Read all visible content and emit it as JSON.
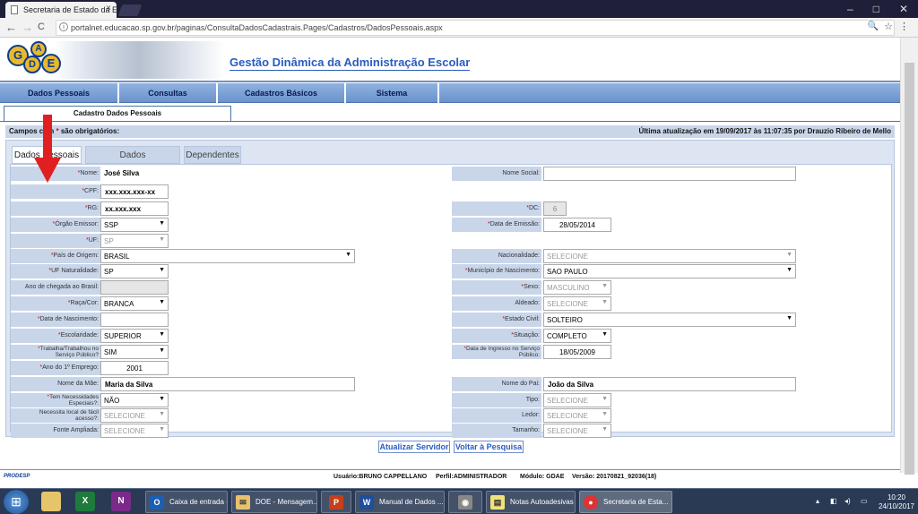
{
  "browser": {
    "tab_title": "Secretaria de Estado da E",
    "tab_close": "×",
    "back": "←",
    "forward": "→",
    "reload": "C",
    "url": "portalnet.educacao.sp.gov.br/paginas/ConsultaDadosCadastrais.Pages/Cadastros/DadosPessoais.aspx",
    "win_min": "–",
    "win_max": "□",
    "win_close": "✕"
  },
  "header": {
    "logo_letters": [
      "G",
      "D",
      "A",
      "E"
    ],
    "title": "Gestão Dinâmica da Administração Escolar"
  },
  "topnav": [
    "Dados Pessoais",
    "Consultas",
    "Cadastros Básicos",
    "Sistema"
  ],
  "subtab": "Cadastro Dados Pessoais",
  "info": {
    "required_prefix": "Campos com",
    "required_star": "*",
    "required_suffix": " são obrigatórios:",
    "last_update": "Última atualização em 19/09/2017 às 11:07:35 por Drauzio Ribeiro de Mello"
  },
  "form_tabs": [
    "Dados Pessoais",
    "Dados Complementares",
    "Dependentes"
  ],
  "form": {
    "nome": {
      "label": "Nome:",
      "value": "José Silva"
    },
    "nome_social": {
      "label": "Nome Social:",
      "value": ""
    },
    "cpf": {
      "label": "CPF:",
      "value": "xxx.xxx.xxx-xx"
    },
    "rg": {
      "label": "RG:",
      "value": "xx.xxx.xxx"
    },
    "dc": {
      "label": "DC:",
      "value": "6"
    },
    "orgao": {
      "label": "Órgão Emissor:",
      "value": "SSP"
    },
    "data_emissao": {
      "label": "Data de Emissão:",
      "value": "28/05/2014"
    },
    "uf": {
      "label": "UF:",
      "value": "SP"
    },
    "pais": {
      "label": "País de Origem:",
      "value": "BRASIL"
    },
    "nacionalidade": {
      "label": "Nacionalidade:",
      "value": "SELECIONE"
    },
    "uf_nat": {
      "label": "UF Naturalidade:",
      "value": "SP"
    },
    "municipio": {
      "label": "Município de Nascimento:",
      "value": "SAO PAULO"
    },
    "ano_chegada": {
      "label": "Ano de chegada ao Brasil:",
      "value": ""
    },
    "sexo": {
      "label": "Sexo:",
      "value": "MASCULINO"
    },
    "raca": {
      "label": "Raça/Cor:",
      "value": "BRANCA"
    },
    "aldeado": {
      "label": "Aldeado:",
      "value": "SELECIONE"
    },
    "data_nasc": {
      "label": "Data de Nascimento:",
      "value": ""
    },
    "estado_civil": {
      "label": "Estado Civil:",
      "value": "SOLTEIRO"
    },
    "escolaridade": {
      "label": "Escolaridade:",
      "value": "SUPERIOR"
    },
    "situacao": {
      "label": "Situação:",
      "value": "COMPLETO"
    },
    "trabalha_l1": "Trabalha/Trabalhou no",
    "trabalha_l2": "Serviço Público?",
    "trabalha_value": "SIM",
    "ingresso_l1": "Data de Ingresso no Serviço",
    "ingresso_l2": "Público:",
    "ingresso_value": "18/05/2009",
    "ano_emprego": {
      "label": "Ano do 1º Emprego:",
      "value": "2001"
    },
    "mae": {
      "label": "Nome da Mãe:",
      "value": "Maria da Silva"
    },
    "pai": {
      "label": "Nome do Pai:",
      "value": "João da Silva"
    },
    "necess_l1": "Tem Necessidades",
    "necess_l2": "Especiais?:",
    "necess_value": "NÃO",
    "tipo": {
      "label": "Tipo:",
      "value": "SELECIONE"
    },
    "local_l1": "Necessita local de fácil",
    "local_l2": "acesso?:",
    "local_value": "SELECIONE",
    "ledor": {
      "label": "Ledor:",
      "value": "SELECIONE"
    },
    "fonte": {
      "label": "Fonte Ampliada:",
      "value": "SELECIONE"
    },
    "tamanho": {
      "label": "Tamanho:",
      "value": "SELECIONE"
    }
  },
  "star": "*",
  "arrow_char": "▼",
  "buttons": {
    "update": "Atualizar Servidor",
    "back": "Voltar à Pesquisa"
  },
  "footer": {
    "brand": "PRODESP",
    "usuario": "Usuário:BRUNO CAPPELLANO",
    "perfil": "Perfil:ADMINISTRADOR",
    "modulo": "Módulo: GDAE",
    "versao": "Versão: 20170821_92036(18)"
  },
  "taskbar": {
    "start": "⊞",
    "items": [
      "Caixa de entrada -...",
      "DOE - Mensagem...",
      "Manual de Dados ...",
      "Notas Autoadesivas",
      "Secretaria de Esta..."
    ],
    "time": "10:20",
    "date": "24/10/2017"
  },
  "colors": {
    "accent": "#2a5cbf",
    "nav": "#6b93cc",
    "required": "#e00000"
  }
}
